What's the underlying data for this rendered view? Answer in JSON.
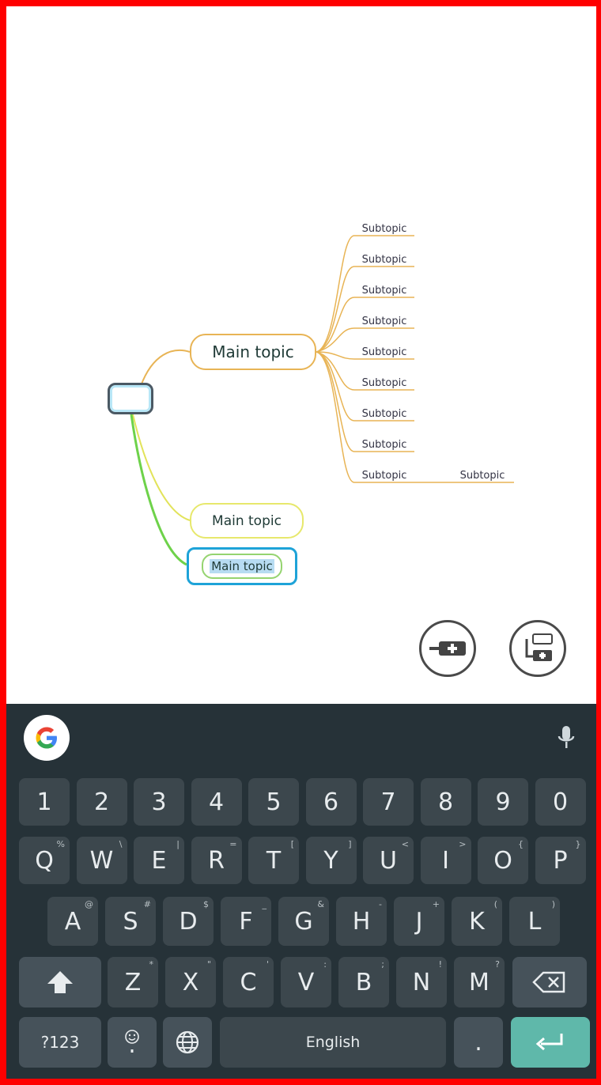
{
  "mindmap": {
    "root_label": "",
    "main_topics": [
      "Main topic",
      "Main topic",
      "Main topic"
    ],
    "subtopics": [
      "Subtopic",
      "Subtopic",
      "Subtopic",
      "Subtopic",
      "Subtopic",
      "Subtopic",
      "Subtopic",
      "Subtopic",
      "Subtopic"
    ],
    "nested_subtopic": "Subtopic"
  },
  "toolbar": {
    "add_sibling_icon": "add-sibling-topic-icon",
    "add_child_icon": "add-child-topic-icon"
  },
  "keyboard": {
    "number_row": [
      "1",
      "2",
      "3",
      "4",
      "5",
      "6",
      "7",
      "8",
      "9",
      "0"
    ],
    "row1": [
      {
        "k": "Q",
        "h": "%"
      },
      {
        "k": "W",
        "h": "\\"
      },
      {
        "k": "E",
        "h": "|"
      },
      {
        "k": "R",
        "h": "="
      },
      {
        "k": "T",
        "h": "["
      },
      {
        "k": "Y",
        "h": "]"
      },
      {
        "k": "U",
        "h": "<"
      },
      {
        "k": "I",
        "h": ">"
      },
      {
        "k": "O",
        "h": "{"
      },
      {
        "k": "P",
        "h": "}"
      }
    ],
    "row2": [
      {
        "k": "A",
        "h": "@"
      },
      {
        "k": "S",
        "h": "#"
      },
      {
        "k": "D",
        "h": "$"
      },
      {
        "k": "F",
        "h": "_"
      },
      {
        "k": "G",
        "h": "&"
      },
      {
        "k": "H",
        "h": "-"
      },
      {
        "k": "J",
        "h": "+"
      },
      {
        "k": "K",
        "h": "("
      },
      {
        "k": "L",
        "h": ")"
      }
    ],
    "row3": [
      {
        "k": "Z",
        "h": "*"
      },
      {
        "k": "X",
        "h": "\""
      },
      {
        "k": "C",
        "h": "'"
      },
      {
        "k": "V",
        "h": ":"
      },
      {
        "k": "B",
        "h": ";"
      },
      {
        "k": "N",
        "h": "!"
      },
      {
        "k": "M",
        "h": "?"
      }
    ],
    "symbols_label": "?123",
    "space_label": "English",
    "period_label": ".",
    "colors": {
      "background": "#263238",
      "key": "#3c474d",
      "enter": "#5fb8aa"
    }
  }
}
